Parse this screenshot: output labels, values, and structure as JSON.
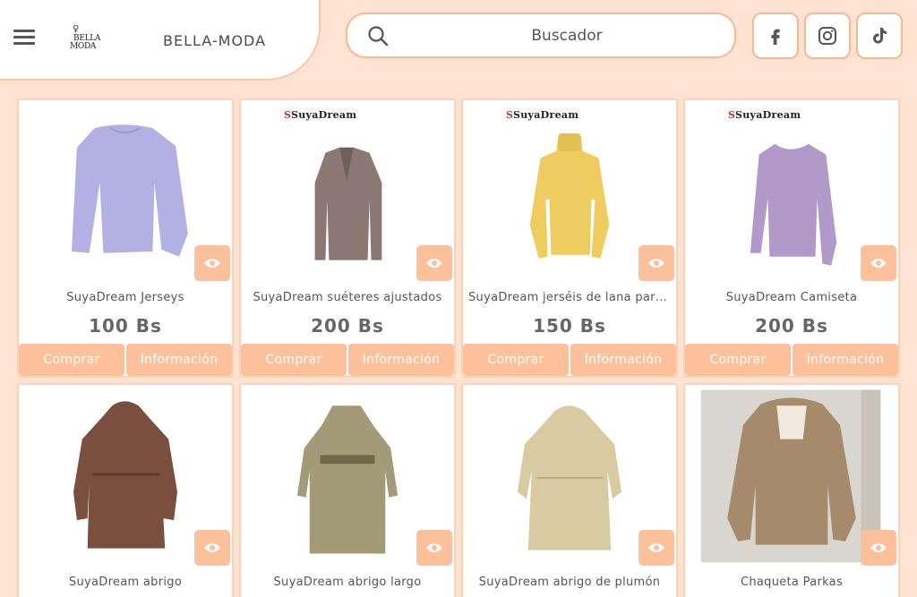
{
  "header": {
    "brand": "BELLA-MODA",
    "logo_line1": "BELLA",
    "logo_line2": "MODA",
    "search_placeholder": "Buscador",
    "social": [
      "facebook-icon",
      "instagram-icon",
      "tiktok-icon"
    ]
  },
  "colors": {
    "background": "#ffe3d2",
    "accent": "#fcc09a",
    "border": "#f7b88f"
  },
  "products": [
    {
      "brand_tag": "",
      "name": "SuyaDream Jerseys",
      "price": "100 Bs",
      "buy": "Comprar",
      "info": "Información",
      "item": "sweater-lilac"
    },
    {
      "brand_tag": "SuyaDream",
      "name": "SuyaDream suéteres ajustados",
      "price": "200 Bs",
      "buy": "Comprar",
      "info": "Información",
      "item": "cardigan-mocha"
    },
    {
      "brand_tag": "SuyaDream",
      "name": "SuyaDream jerséis de lana para…",
      "price": "150 Bs",
      "buy": "Comprar",
      "info": "Información",
      "item": "turtleneck-yellow"
    },
    {
      "brand_tag": "SuyaDream",
      "name": "SuyaDream Camiseta",
      "price": "200 Bs",
      "buy": "Comprar",
      "info": "Información",
      "item": "tee-lavender"
    },
    {
      "brand_tag": "",
      "name": "SuyaDream abrigo",
      "item": "coat-brown"
    },
    {
      "brand_tag": "",
      "name": "SuyaDream abrigo largo",
      "item": "coat-olive"
    },
    {
      "brand_tag": "",
      "name": "SuyaDream abrigo de plumón",
      "item": "coat-beige"
    },
    {
      "brand_tag": "",
      "name": "Chaqueta Parkas",
      "item": "parka-photo"
    }
  ]
}
